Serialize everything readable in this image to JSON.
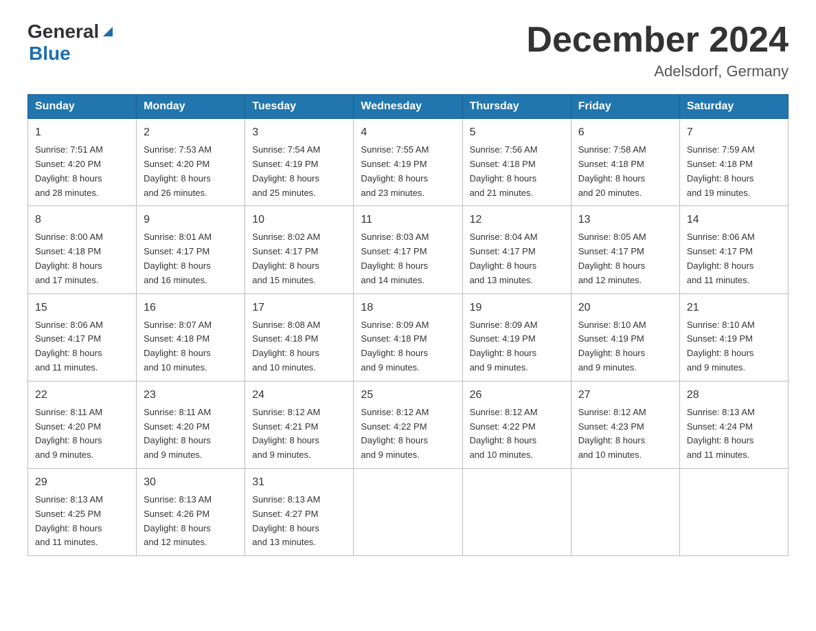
{
  "header": {
    "logo_general": "General",
    "logo_blue": "Blue",
    "month_title": "December 2024",
    "location": "Adelsdorf, Germany"
  },
  "days_of_week": [
    "Sunday",
    "Monday",
    "Tuesday",
    "Wednesday",
    "Thursday",
    "Friday",
    "Saturday"
  ],
  "weeks": [
    [
      {
        "day": "1",
        "sunrise": "7:51 AM",
        "sunset": "4:20 PM",
        "daylight": "8 hours and 28 minutes."
      },
      {
        "day": "2",
        "sunrise": "7:53 AM",
        "sunset": "4:20 PM",
        "daylight": "8 hours and 26 minutes."
      },
      {
        "day": "3",
        "sunrise": "7:54 AM",
        "sunset": "4:19 PM",
        "daylight": "8 hours and 25 minutes."
      },
      {
        "day": "4",
        "sunrise": "7:55 AM",
        "sunset": "4:19 PM",
        "daylight": "8 hours and 23 minutes."
      },
      {
        "day": "5",
        "sunrise": "7:56 AM",
        "sunset": "4:18 PM",
        "daylight": "8 hours and 21 minutes."
      },
      {
        "day": "6",
        "sunrise": "7:58 AM",
        "sunset": "4:18 PM",
        "daylight": "8 hours and 20 minutes."
      },
      {
        "day": "7",
        "sunrise": "7:59 AM",
        "sunset": "4:18 PM",
        "daylight": "8 hours and 19 minutes."
      }
    ],
    [
      {
        "day": "8",
        "sunrise": "8:00 AM",
        "sunset": "4:18 PM",
        "daylight": "8 hours and 17 minutes."
      },
      {
        "day": "9",
        "sunrise": "8:01 AM",
        "sunset": "4:17 PM",
        "daylight": "8 hours and 16 minutes."
      },
      {
        "day": "10",
        "sunrise": "8:02 AM",
        "sunset": "4:17 PM",
        "daylight": "8 hours and 15 minutes."
      },
      {
        "day": "11",
        "sunrise": "8:03 AM",
        "sunset": "4:17 PM",
        "daylight": "8 hours and 14 minutes."
      },
      {
        "day": "12",
        "sunrise": "8:04 AM",
        "sunset": "4:17 PM",
        "daylight": "8 hours and 13 minutes."
      },
      {
        "day": "13",
        "sunrise": "8:05 AM",
        "sunset": "4:17 PM",
        "daylight": "8 hours and 12 minutes."
      },
      {
        "day": "14",
        "sunrise": "8:06 AM",
        "sunset": "4:17 PM",
        "daylight": "8 hours and 11 minutes."
      }
    ],
    [
      {
        "day": "15",
        "sunrise": "8:06 AM",
        "sunset": "4:17 PM",
        "daylight": "8 hours and 11 minutes."
      },
      {
        "day": "16",
        "sunrise": "8:07 AM",
        "sunset": "4:18 PM",
        "daylight": "8 hours and 10 minutes."
      },
      {
        "day": "17",
        "sunrise": "8:08 AM",
        "sunset": "4:18 PM",
        "daylight": "8 hours and 10 minutes."
      },
      {
        "day": "18",
        "sunrise": "8:09 AM",
        "sunset": "4:18 PM",
        "daylight": "8 hours and 9 minutes."
      },
      {
        "day": "19",
        "sunrise": "8:09 AM",
        "sunset": "4:19 PM",
        "daylight": "8 hours and 9 minutes."
      },
      {
        "day": "20",
        "sunrise": "8:10 AM",
        "sunset": "4:19 PM",
        "daylight": "8 hours and 9 minutes."
      },
      {
        "day": "21",
        "sunrise": "8:10 AM",
        "sunset": "4:19 PM",
        "daylight": "8 hours and 9 minutes."
      }
    ],
    [
      {
        "day": "22",
        "sunrise": "8:11 AM",
        "sunset": "4:20 PM",
        "daylight": "8 hours and 9 minutes."
      },
      {
        "day": "23",
        "sunrise": "8:11 AM",
        "sunset": "4:20 PM",
        "daylight": "8 hours and 9 minutes."
      },
      {
        "day": "24",
        "sunrise": "8:12 AM",
        "sunset": "4:21 PM",
        "daylight": "8 hours and 9 minutes."
      },
      {
        "day": "25",
        "sunrise": "8:12 AM",
        "sunset": "4:22 PM",
        "daylight": "8 hours and 9 minutes."
      },
      {
        "day": "26",
        "sunrise": "8:12 AM",
        "sunset": "4:22 PM",
        "daylight": "8 hours and 10 minutes."
      },
      {
        "day": "27",
        "sunrise": "8:12 AM",
        "sunset": "4:23 PM",
        "daylight": "8 hours and 10 minutes."
      },
      {
        "day": "28",
        "sunrise": "8:13 AM",
        "sunset": "4:24 PM",
        "daylight": "8 hours and 11 minutes."
      }
    ],
    [
      {
        "day": "29",
        "sunrise": "8:13 AM",
        "sunset": "4:25 PM",
        "daylight": "8 hours and 11 minutes."
      },
      {
        "day": "30",
        "sunrise": "8:13 AM",
        "sunset": "4:26 PM",
        "daylight": "8 hours and 12 minutes."
      },
      {
        "day": "31",
        "sunrise": "8:13 AM",
        "sunset": "4:27 PM",
        "daylight": "8 hours and 13 minutes."
      },
      null,
      null,
      null,
      null
    ]
  ],
  "labels": {
    "sunrise": "Sunrise:",
    "sunset": "Sunset:",
    "daylight": "Daylight:"
  }
}
